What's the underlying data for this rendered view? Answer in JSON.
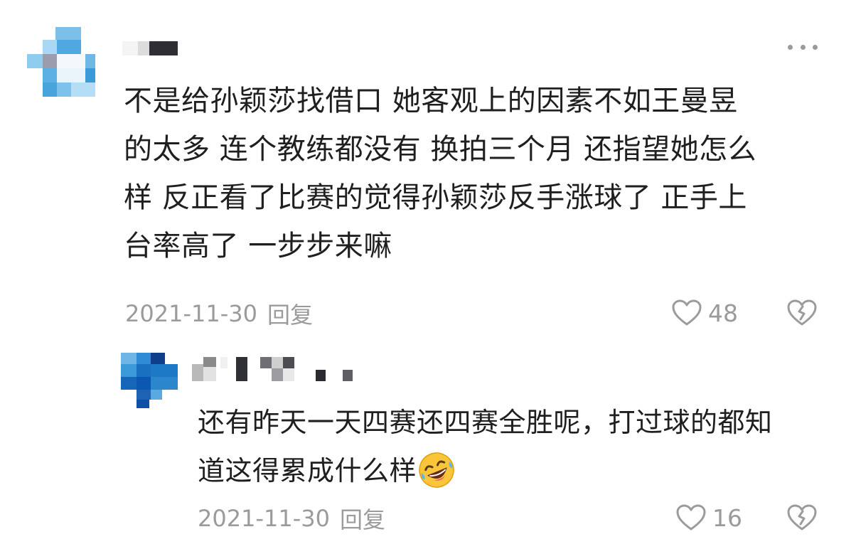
{
  "comment": {
    "text_lines": [
      "不是给孙颖莎找借口 她客观上的因素不如王曼昱",
      "的太多 连个教练都没有 换拍三个月 还指望她怎么",
      "样 反正看了比赛的觉得孙颖莎反手涨球了 正手上",
      "台率高了 一步步来嘛"
    ],
    "date": "2021-11-30",
    "reply_label": "回复",
    "likes": "48"
  },
  "reply": {
    "text_lines": [
      "还有昨天一天四赛还四赛全胜呢，打过球的都知",
      "道这得累成什么样"
    ],
    "emoji": "rolling-on-floor-laughing-emoji",
    "date": "2021-11-30",
    "reply_label": "回复",
    "likes": "16"
  },
  "icons": {
    "more": "more-dots-icon",
    "like": "heart-icon",
    "dislike": "broken-heart-icon"
  },
  "colors": {
    "text": "#1f1f1f",
    "meta": "#9b9b9b",
    "avatar_main": "#5aaee0",
    "avatar_reply": "#1f7fc8"
  }
}
